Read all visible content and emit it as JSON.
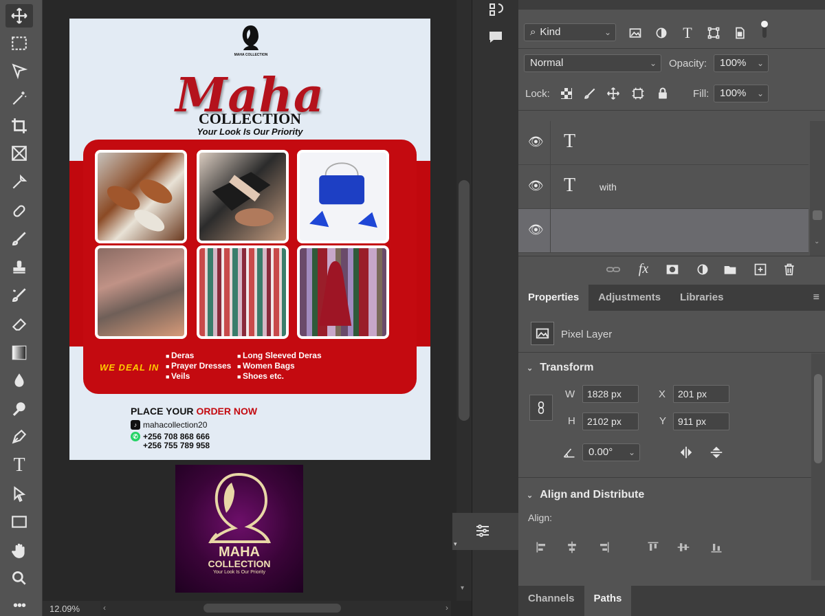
{
  "app": {
    "zoom": "12.09%"
  },
  "toolbar": {
    "tools": [
      "move-icon",
      "marquee-icon",
      "lasso-icon",
      "magic-wand-icon",
      "crop-icon",
      "frame-icon",
      "eyedropper-icon",
      "healing-brush-icon",
      "brush-icon",
      "clone-stamp-icon",
      "history-brush-icon",
      "eraser-icon",
      "gradient-icon",
      "blur-icon",
      "dodge-icon",
      "pen-icon",
      "type-icon",
      "path-select-icon",
      "rectangle-icon",
      "hand-icon",
      "zoom-icon",
      "more-icon"
    ]
  },
  "flyer": {
    "logo_small_text": "MAHA COLLECTION",
    "title": "Maha",
    "subtitle": "COLLECTION",
    "tagline": "Your Look Is Our Priority",
    "deal_label": "WE DEAL IN",
    "deal_col1": [
      "Deras",
      "Prayer Dresses",
      "Veils"
    ],
    "deal_col2": [
      "Long Sleeved Deras",
      "Women Bags",
      "Shoes etc."
    ],
    "order_prefix": "PLACE YOUR ",
    "order_highlight": "ORDER NOW",
    "tiktok": "mahacollection20",
    "phone1": "+256 708 868 666",
    "phone2": "+256 755 789 958",
    "accent": "#c40a10"
  },
  "logo_big": {
    "line1": "MAHA",
    "line2": "COLLECTION",
    "line3": "Your Look Is Our Priority"
  },
  "layers_panel": {
    "filter_kind": "Kind",
    "blend_mode": "Normal",
    "opacity_label": "Opacity:",
    "opacity_value": "100%",
    "lock_label": "Lock:",
    "fill_label": "Fill:",
    "fill_value": "100%",
    "layers": [
      {
        "type": "text",
        "name": ""
      },
      {
        "type": "text",
        "name": "with"
      },
      {
        "type": "pixel",
        "name": ""
      }
    ]
  },
  "properties_panel": {
    "tabs": [
      "Properties",
      "Adjustments",
      "Libraries"
    ],
    "layer_kind": "Pixel Layer",
    "transform_title": "Transform",
    "w_label": "W",
    "w_value": "1828 px",
    "h_label": "H",
    "h_value": "2102 px",
    "x_label": "X",
    "x_value": "201 px",
    "y_label": "Y",
    "y_value": "911 px",
    "angle_value": "0.00°",
    "align_title": "Align and Distribute",
    "align_label": "Align:"
  },
  "bottom_tabs": [
    "Channels",
    "Paths"
  ]
}
